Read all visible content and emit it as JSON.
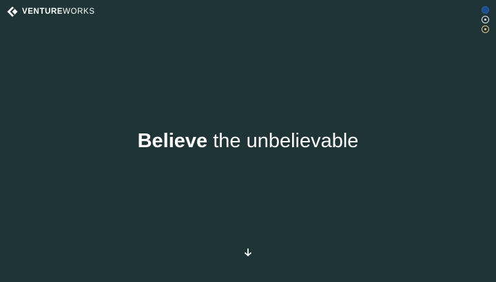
{
  "header": {
    "logo": {
      "text_bold": "VENTURE",
      "text_light": "WORKS",
      "icon": "venture-works-logo-icon"
    }
  },
  "nav_dots": [
    {
      "name": "section-1",
      "state": "active",
      "color": "#1d4f8c"
    },
    {
      "name": "section-2",
      "state": "inactive",
      "color": "#e8ecec"
    },
    {
      "name": "section-3",
      "state": "inactive",
      "color": "#e3c98e"
    }
  ],
  "hero": {
    "headline_strong": "Believe",
    "headline_rest": " the unbelievable"
  },
  "scroll": {
    "icon": "arrow-down-icon"
  },
  "colors": {
    "background": "#1f3436",
    "text": "#ffffff",
    "accent_blue": "#1d4f8c",
    "accent_gold": "#e3c98e"
  }
}
